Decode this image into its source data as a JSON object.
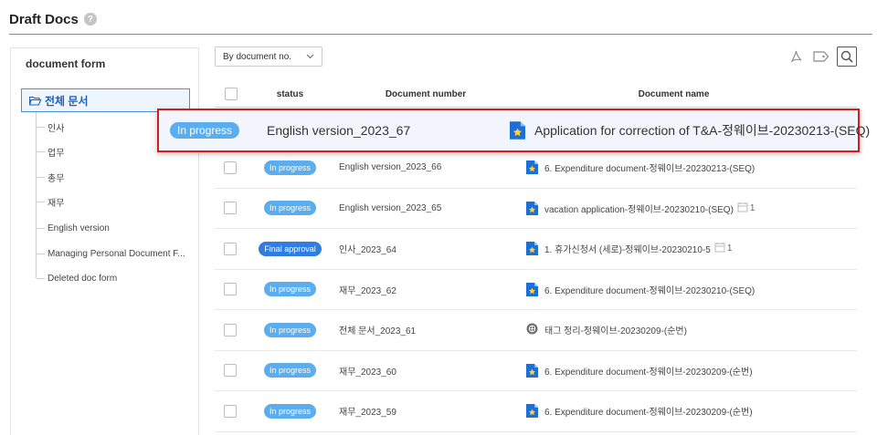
{
  "header": {
    "title": "Draft Docs",
    "help_icon": "question-circle-icon"
  },
  "sidebar": {
    "title": "document form",
    "root": {
      "label": "전체 문서",
      "icon": "folder-open-icon"
    },
    "items": [
      {
        "label": "인사"
      },
      {
        "label": "업무"
      },
      {
        "label": "총무"
      },
      {
        "label": "재무"
      },
      {
        "label": "English version"
      },
      {
        "label": "Managing Personal Document F..."
      },
      {
        "label": "Deleted doc form"
      }
    ]
  },
  "toolbar": {
    "sort_value": "By document no.",
    "icons": [
      "pdf-icon",
      "tag-icon",
      "search-icon"
    ]
  },
  "table": {
    "columns": {
      "status": "status",
      "number": "Document number",
      "name": "Document name"
    },
    "highlight": {
      "status": "In progress",
      "number": "English version_2023_67",
      "name": "Application for correction of T&A-정웨이브-20230213-(SEQ)"
    },
    "rows": [
      {
        "status": "In progress",
        "number": "English version_2023_66",
        "name": "6. Expenditure document-정웨이브-20230213-(SEQ)",
        "icon": "star-doc-icon",
        "attach": ""
      },
      {
        "status": "In progress",
        "number": "English version_2023_65",
        "name": "vacation application-정웨이브-20230210-(SEQ)",
        "icon": "star-doc-icon",
        "attach": "1"
      },
      {
        "status": "Final approval",
        "number": "인사_2023_64",
        "name": "1. 휴가신청서 (세로)-정웨이브-20230210-5",
        "icon": "star-doc-icon",
        "attach": "1"
      },
      {
        "status": "In progress",
        "number": "재무_2023_62",
        "name": "6. Expenditure document-정웨이브-20230210-(SEQ)",
        "icon": "star-doc-icon",
        "attach": ""
      },
      {
        "status": "In progress",
        "number": "전체 문서_2023_61",
        "name": "태그 정리-정웨이브-20230209-(순번)",
        "icon": "globe-doc-icon",
        "attach": ""
      },
      {
        "status": "In progress",
        "number": "재무_2023_60",
        "name": "6. Expenditure document-정웨이브-20230209-(순번)",
        "icon": "star-doc-icon",
        "attach": ""
      },
      {
        "status": "In progress",
        "number": "재무_2023_59",
        "name": "6. Expenditure document-정웨이브-20230209-(순번)",
        "icon": "star-doc-icon",
        "attach": ""
      }
    ]
  },
  "colors": {
    "in_progress": "#5aaef0",
    "final_approval": "#2f7de1",
    "highlight_border": "#d21d1d",
    "accent": "#1a5fbf"
  }
}
